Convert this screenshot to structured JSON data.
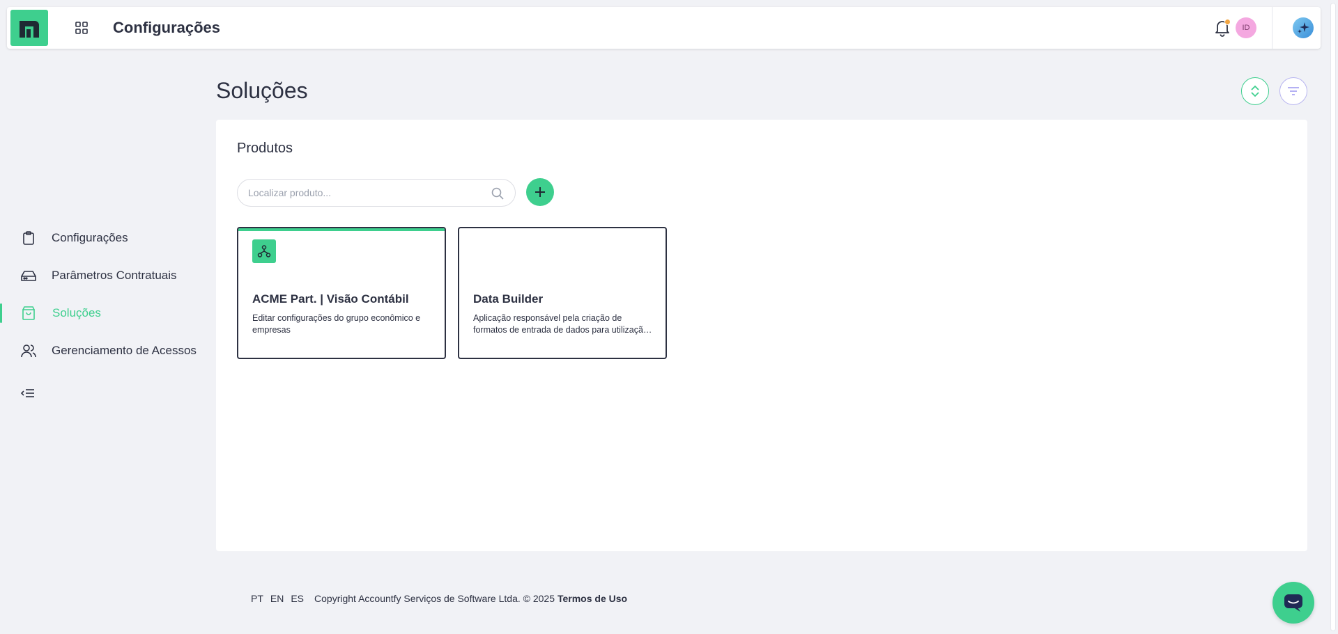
{
  "header": {
    "title": "Configurações",
    "avatar_initials": "ID",
    "icons": [
      "app-logo-icon",
      "apps-grid-icon",
      "bell-icon",
      "sparkle-ai-icon"
    ],
    "accent_color": "#3ecf8e",
    "notification_dot_color": "#f2a541"
  },
  "sidebar": {
    "items": [
      {
        "label": "Configurações",
        "icon": "clipboard-icon",
        "active": false
      },
      {
        "label": "Parâmetros Contratuais",
        "icon": "drive-icon",
        "active": false
      },
      {
        "label": "Soluções",
        "icon": "shopping-bag-icon",
        "active": true
      },
      {
        "label": "Gerenciamento de Acessos",
        "icon": "users-icon",
        "active": false
      }
    ],
    "collapse_icon": "collapse-menu-icon"
  },
  "main": {
    "title": "Soluções",
    "panel": {
      "title": "Produtos",
      "search_placeholder": "Localizar produto...",
      "cards": [
        {
          "title": "ACME Part. | Visão Contábil",
          "description": "Editar configurações do grupo econômico e empresas",
          "icon": "hierarchy-icon",
          "highlighted": true
        },
        {
          "title": "Data Builder",
          "description": "Aplicação responsável pela criação de formatos de entrada de dados para utilização em outras aplicações",
          "highlighted": false
        }
      ]
    }
  },
  "footer": {
    "languages": [
      "PT",
      "EN",
      "ES"
    ],
    "copyright": "Copyright Accountfy Serviços de Software Ltda. © 2025",
    "terms": "Termos de Uso"
  }
}
